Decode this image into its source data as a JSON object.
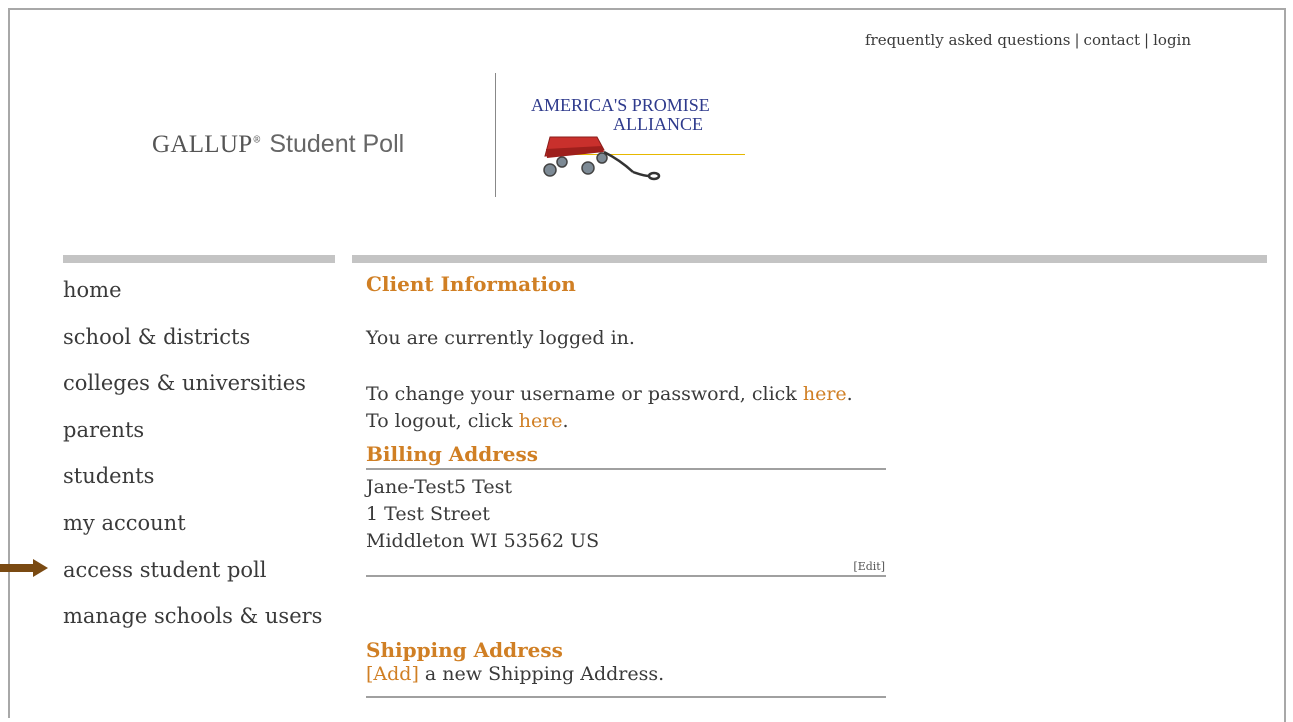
{
  "top_links": {
    "faq": "frequently asked questions",
    "contact": "contact",
    "login": "login",
    "separator": "|"
  },
  "logos": {
    "gallup_brand": "GALLUP",
    "gallup_reg": "®",
    "gallup_product": "Student Poll",
    "apa_line1": "AMERICA'S PROMISE",
    "apa_line2": "ALLIANCE"
  },
  "sidebar": {
    "items": [
      {
        "label": "home"
      },
      {
        "label": "school & districts"
      },
      {
        "label": "colleges & universities"
      },
      {
        "label": "parents"
      },
      {
        "label": "students"
      },
      {
        "label": "my account"
      },
      {
        "label": "access student poll"
      },
      {
        "label": "manage schools & users"
      }
    ]
  },
  "main": {
    "title": "Client Information",
    "logged_in": "You are currently logged in.",
    "change_prefix": "To change your username or password, click ",
    "change_link": "here",
    "change_suffix": ".",
    "logout_prefix": "To logout, click ",
    "logout_link": "here",
    "logout_suffix": ".",
    "billing": {
      "heading": "Billing Address",
      "name": "Jane-Test5 Test",
      "street": "1 Test Street",
      "city": "Middleton WI 53562 US",
      "edit": "[Edit]"
    },
    "shipping": {
      "heading": "Shipping Address",
      "add": "[Add]",
      "add_suffix": " a new Shipping Address."
    }
  },
  "colors": {
    "accent": "#d07f24",
    "arrow": "#7a4a12",
    "bar": "#c4c4c4",
    "apa_text": "#2e3a8c"
  }
}
